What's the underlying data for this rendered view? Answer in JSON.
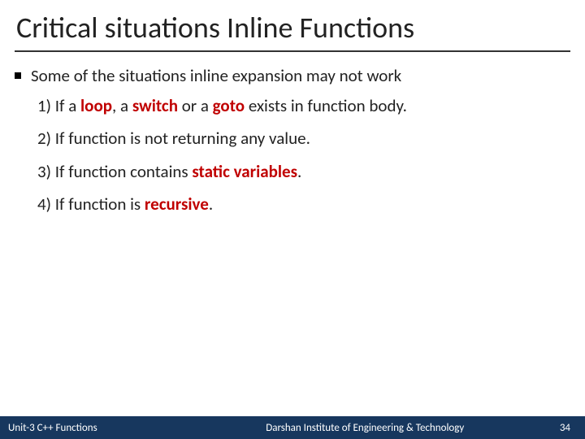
{
  "title": "Critical situations Inline Functions",
  "intro": "Some of the situations inline expansion may not work",
  "items": {
    "i1_pre": "1) If a ",
    "i1_kw1": "loop",
    "i1_mid1": ", a ",
    "i1_kw2": "switch",
    "i1_mid2": " or a ",
    "i1_kw3": "goto",
    "i1_post": " exists in function body.",
    "i2": "2) If function is not returning any value.",
    "i3_pre": "3) If function contains ",
    "i3_kw": "static variables",
    "i3_post": ".",
    "i4_pre": "4) If function is ",
    "i4_kw": "recursive",
    "i4_post": "."
  },
  "footer": {
    "left": "Unit-3 C++ Functions",
    "center": "Darshan Institute of Engineering & Technology",
    "pageNo": "34"
  }
}
